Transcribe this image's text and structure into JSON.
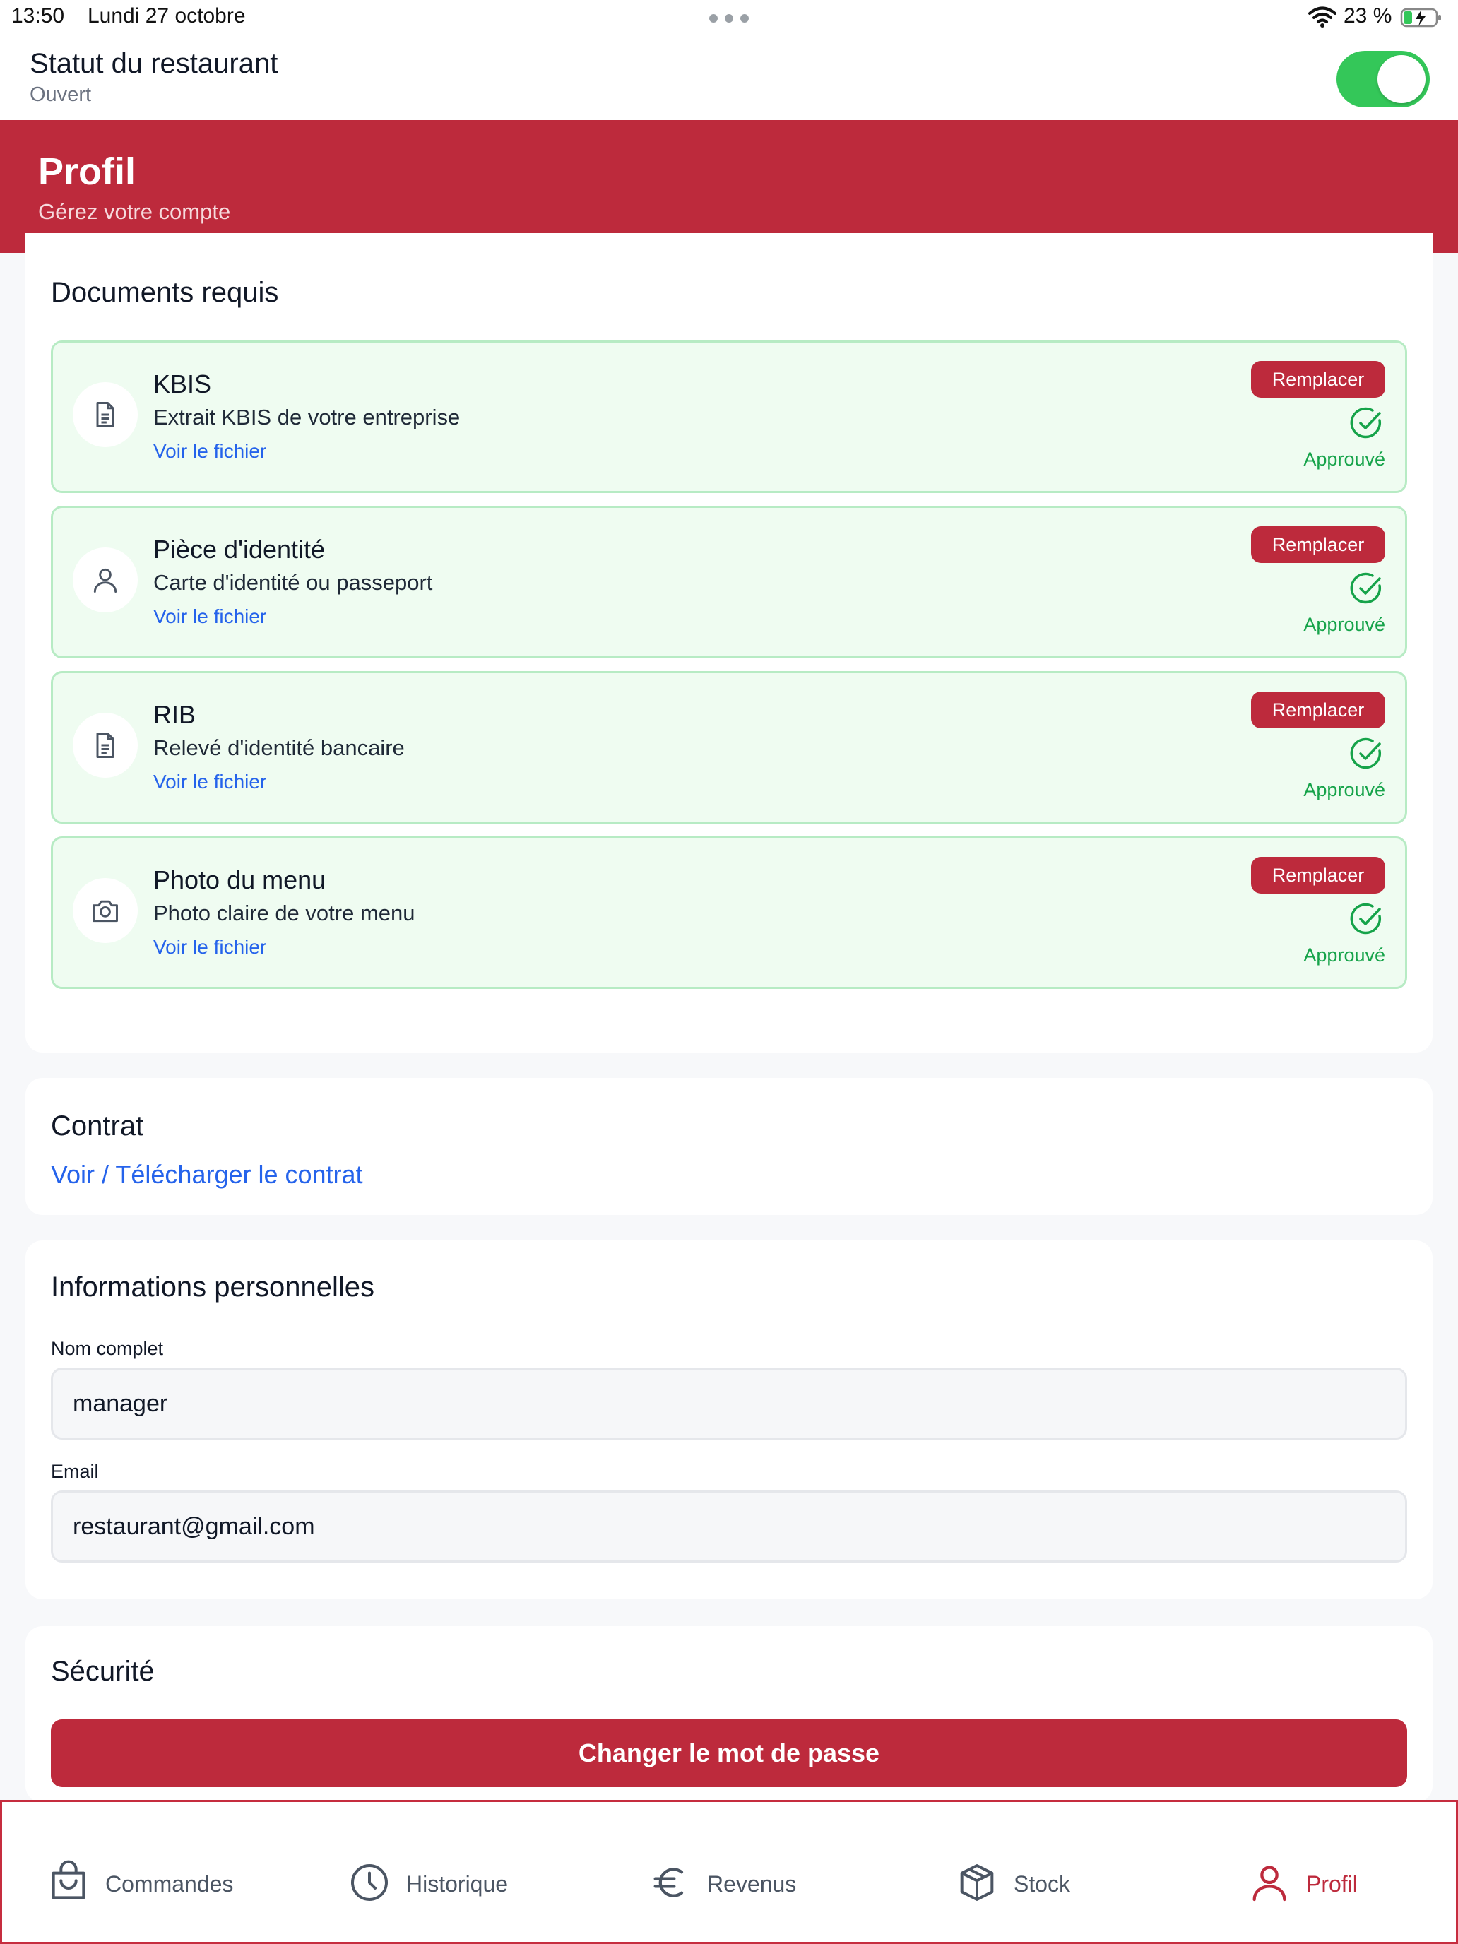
{
  "status_bar": {
    "time": "13:50",
    "date": "Lundi 27 octobre",
    "battery": "23 %"
  },
  "restaurant": {
    "title": "Statut du restaurant",
    "status": "Ouvert",
    "open": true
  },
  "banner": {
    "title": "Profil",
    "subtitle": "Gérez votre compte"
  },
  "documents": {
    "title": "Documents requis",
    "items": [
      {
        "name": "KBIS",
        "description": "Extrait KBIS de votre entreprise",
        "link": "Voir le fichier",
        "button": "Remplacer",
        "status": "Approuvé",
        "icon": "document-icon"
      },
      {
        "name": "Pièce d'identité",
        "description": "Carte d'identité ou passeport",
        "link": "Voir le fichier",
        "button": "Remplacer",
        "status": "Approuvé",
        "icon": "user-icon"
      },
      {
        "name": "RIB",
        "description": "Relevé d'identité bancaire",
        "link": "Voir le fichier",
        "button": "Remplacer",
        "status": "Approuvé",
        "icon": "document-icon"
      },
      {
        "name": "Photo du menu",
        "description": "Photo claire de votre menu",
        "link": "Voir le fichier",
        "button": "Remplacer",
        "status": "Approuvé",
        "icon": "camera-icon"
      }
    ]
  },
  "contract": {
    "title": "Contrat",
    "link": "Voir / Télécharger le contrat"
  },
  "personal": {
    "title": "Informations personnelles",
    "name_label": "Nom complet",
    "name_value": "manager",
    "email_label": "Email",
    "email_value": "restaurant@gmail.com"
  },
  "security": {
    "title": "Sécurité",
    "button": "Changer le mot de passe"
  },
  "nav": {
    "items": [
      {
        "label": "Commandes",
        "icon": "shopping-bag-icon"
      },
      {
        "label": "Historique",
        "icon": "clock-icon"
      },
      {
        "label": "Revenus",
        "icon": "euro-icon"
      },
      {
        "label": "Stock",
        "icon": "box-icon"
      },
      {
        "label": "Profil",
        "icon": "user-icon",
        "active": true
      }
    ]
  },
  "colors": {
    "brand": "#bd2a3c",
    "success": "#16a34a",
    "link": "#2563eb",
    "toggle": "#34c759"
  }
}
